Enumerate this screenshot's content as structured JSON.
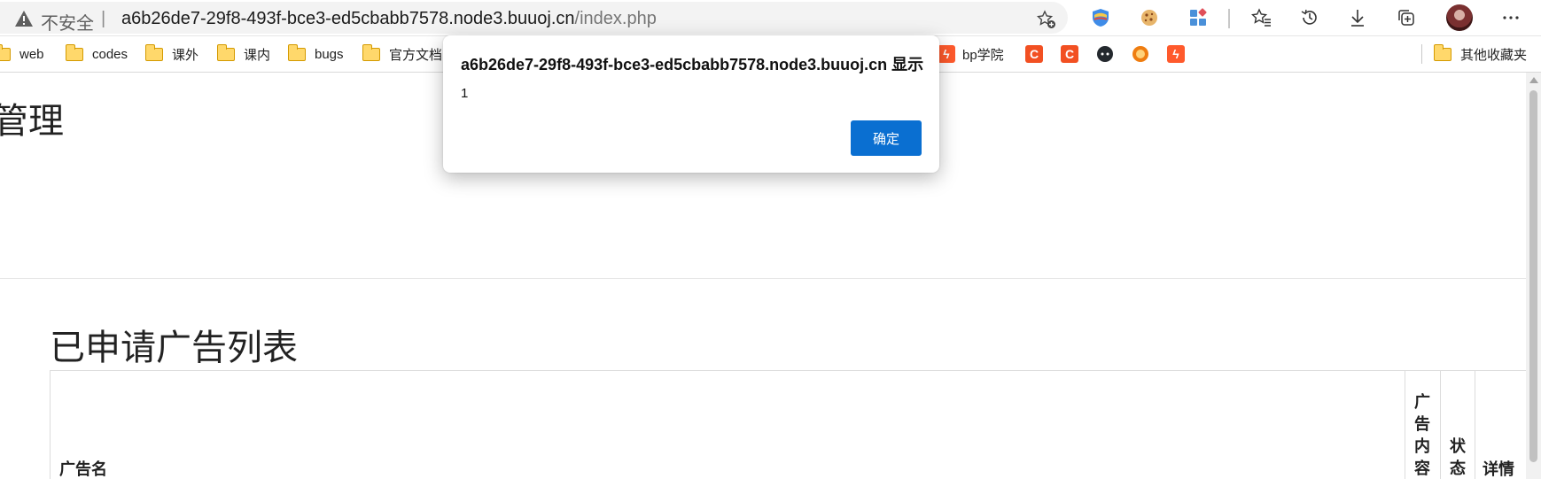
{
  "browser": {
    "security_label": "不安全",
    "separator": "|",
    "url_host": "a6b26de7-29f8-493f-bce3-ed5cbabb7578.node3.buuoj.cn",
    "url_path": "/index.php",
    "toolbar_icons": [
      "add-favorite-icon",
      "extension-shield-icon",
      "cookie-icon",
      "extensions-icon",
      "favorites-icon",
      "history-icon",
      "download-icon",
      "collections-icon",
      "profile-avatar",
      "more-icon"
    ]
  },
  "bookmarks": {
    "items": [
      {
        "label": "web",
        "icon": "folder-icon"
      },
      {
        "label": "codes",
        "icon": "folder-icon"
      },
      {
        "label": "课外",
        "icon": "folder-icon"
      },
      {
        "label": "课内",
        "icon": "folder-icon"
      },
      {
        "label": "bugs",
        "icon": "folder-icon"
      },
      {
        "label": "官方文档",
        "icon": "folder-icon"
      },
      {
        "label": "bp学院",
        "icon": "bolt-icon"
      }
    ],
    "other_label": "其他收藏夹",
    "colors": {
      "orange": "#f25022",
      "bolt": "#ff5a2c",
      "github": "#24292e"
    }
  },
  "page": {
    "title_fragment": "管理",
    "section_title": "已申请广告列表",
    "table_headers": [
      "广告名",
      "广告内容",
      "状态",
      "详情"
    ]
  },
  "dialog": {
    "title": "a6b26de7-29f8-493f-bce3-ed5cbabb7578.node3.buuoj.cn 显示",
    "message": "1",
    "ok_label": "确定",
    "accent": "#0a6fd1"
  }
}
